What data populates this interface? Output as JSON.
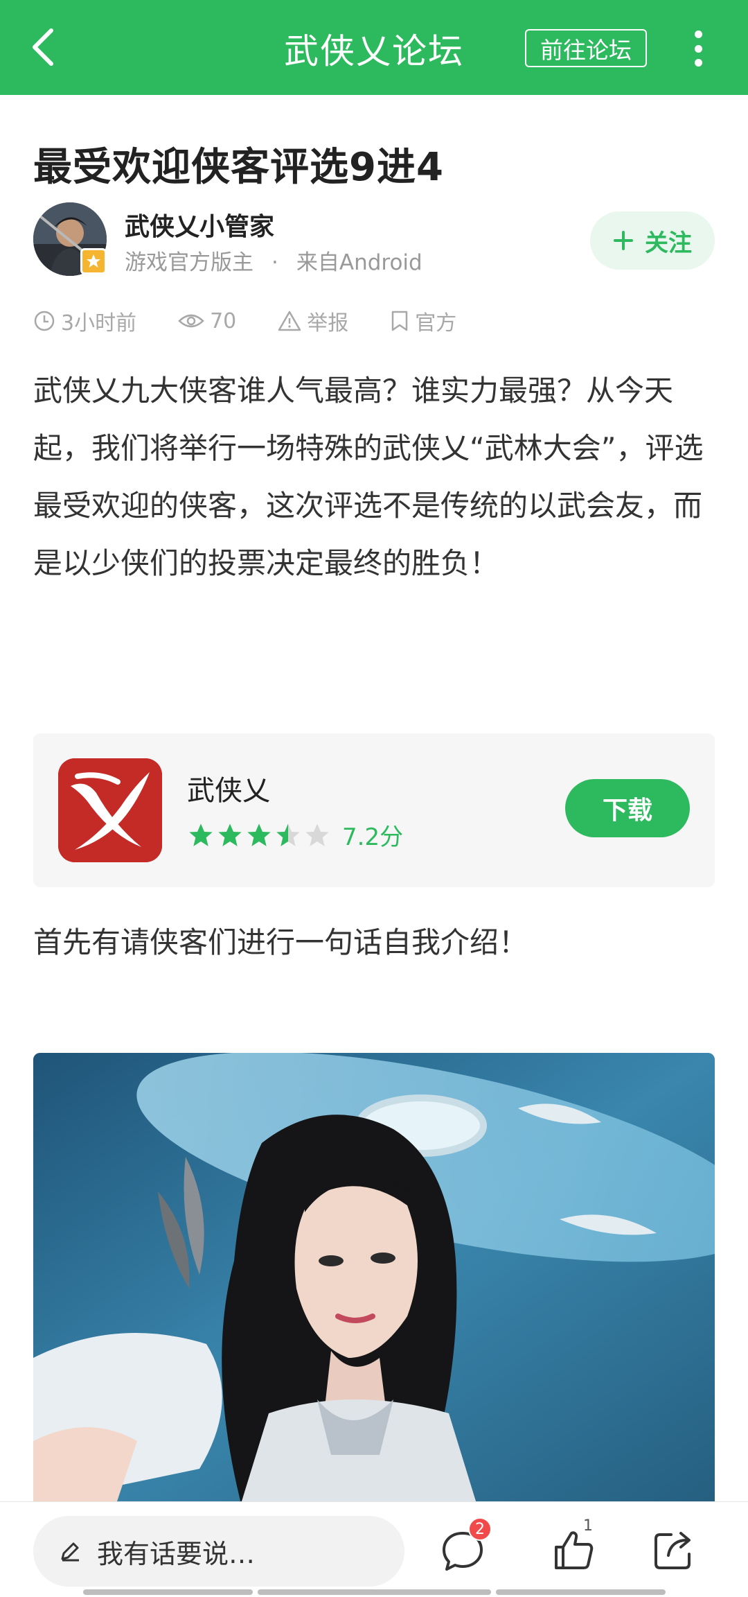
{
  "header": {
    "title": "武侠乂论坛",
    "goto_label": "前往论坛",
    "background": "#2dba5e"
  },
  "post": {
    "title": "最受欢迎侠客评选9进4",
    "author": {
      "name": "武侠乂小管家",
      "role": "游戏官方版主",
      "source": "来自Android",
      "separator": "·"
    },
    "follow_label": "关注",
    "stats": {
      "time": "3小时前",
      "views": "70",
      "report_label": "举报",
      "official_label": "官方"
    },
    "paragraph1": "武侠乂九大侠客谁人气最高？谁实力最强？从今天起，我们将举行一场特殊的武侠乂“武林大会”，评选最受欢迎的侠客，这次评选不是传统的以武会友，而是以少侠们的投票决定最终的胜负！",
    "paragraph2": "首先有请侠客们进行一句话自我介绍！"
  },
  "app_card": {
    "name": "武侠乂",
    "score": "7.2分",
    "rating": 3.5,
    "download_label": "下载",
    "icon_color": "#c42a26"
  },
  "bottom_bar": {
    "placeholder": "我有话要说…",
    "comment_badge": "2",
    "like_count": "1"
  },
  "icons": {
    "back": "chevron-left-icon",
    "more": "more-vertical-icon",
    "follow": "plus-icon",
    "time": "clock-icon",
    "views": "eye-icon",
    "report": "warning-icon",
    "official": "bookmark-icon",
    "edit": "pencil-icon",
    "comment": "speech-bubble-icon",
    "like": "thumbs-up-icon",
    "share": "share-icon"
  },
  "colors": {
    "accent": "#2dba5e",
    "accent_light": "#e9f7ee",
    "badge_red": "#f04a4a",
    "badge_gold": "#f5b531"
  }
}
